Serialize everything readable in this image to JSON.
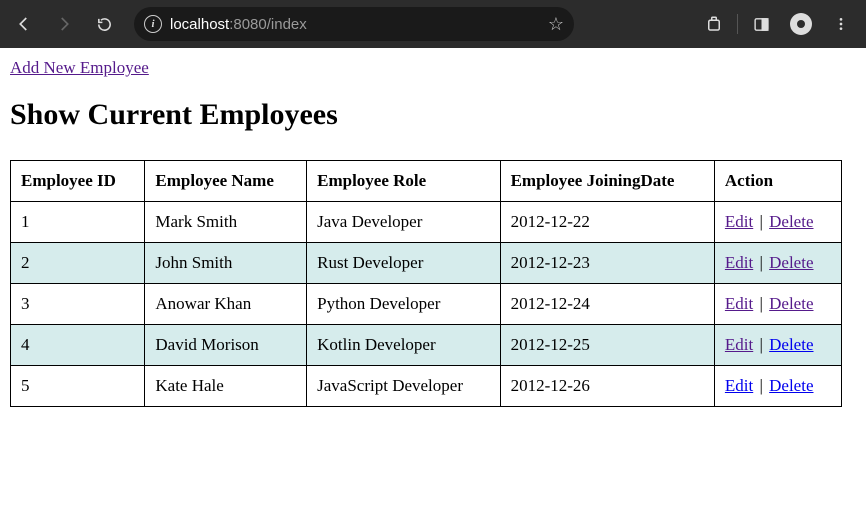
{
  "browser": {
    "host": "localhost",
    "portpath": ":8080/index"
  },
  "page": {
    "add_link": "Add New Employee",
    "heading": "Show Current Employees"
  },
  "table": {
    "headers": [
      "Employee ID",
      "Employee Name",
      "Employee Role",
      "Employee JoiningDate",
      "Action"
    ],
    "rows": [
      {
        "id": "1",
        "name": "Mark Smith",
        "role": "Java Developer",
        "date": "2012-12-22",
        "edit": "Edit",
        "delete": "Delete",
        "edit_color": "#551a8b",
        "delete_color": "#551a8b"
      },
      {
        "id": "2",
        "name": "John Smith",
        "role": "Rust Developer",
        "date": "2012-12-23",
        "edit": "Edit",
        "delete": "Delete",
        "edit_color": "#551a8b",
        "delete_color": "#551a8b"
      },
      {
        "id": "3",
        "name": "Anowar Khan",
        "role": "Python Developer",
        "date": "2012-12-24",
        "edit": "Edit",
        "delete": "Delete",
        "edit_color": "#551a8b",
        "delete_color": "#551a8b"
      },
      {
        "id": "4",
        "name": "David Morison",
        "role": "Kotlin Developer",
        "date": "2012-12-25",
        "edit": "Edit",
        "delete": "Delete",
        "edit_color": "#551a8b",
        "delete_color": "#0000ee"
      },
      {
        "id": "5",
        "name": "Kate Hale",
        "role": "JavaScript Developer",
        "date": "2012-12-26",
        "edit": "Edit",
        "delete": "Delete",
        "edit_color": "#0000ee",
        "delete_color": "#0000ee"
      }
    ]
  }
}
